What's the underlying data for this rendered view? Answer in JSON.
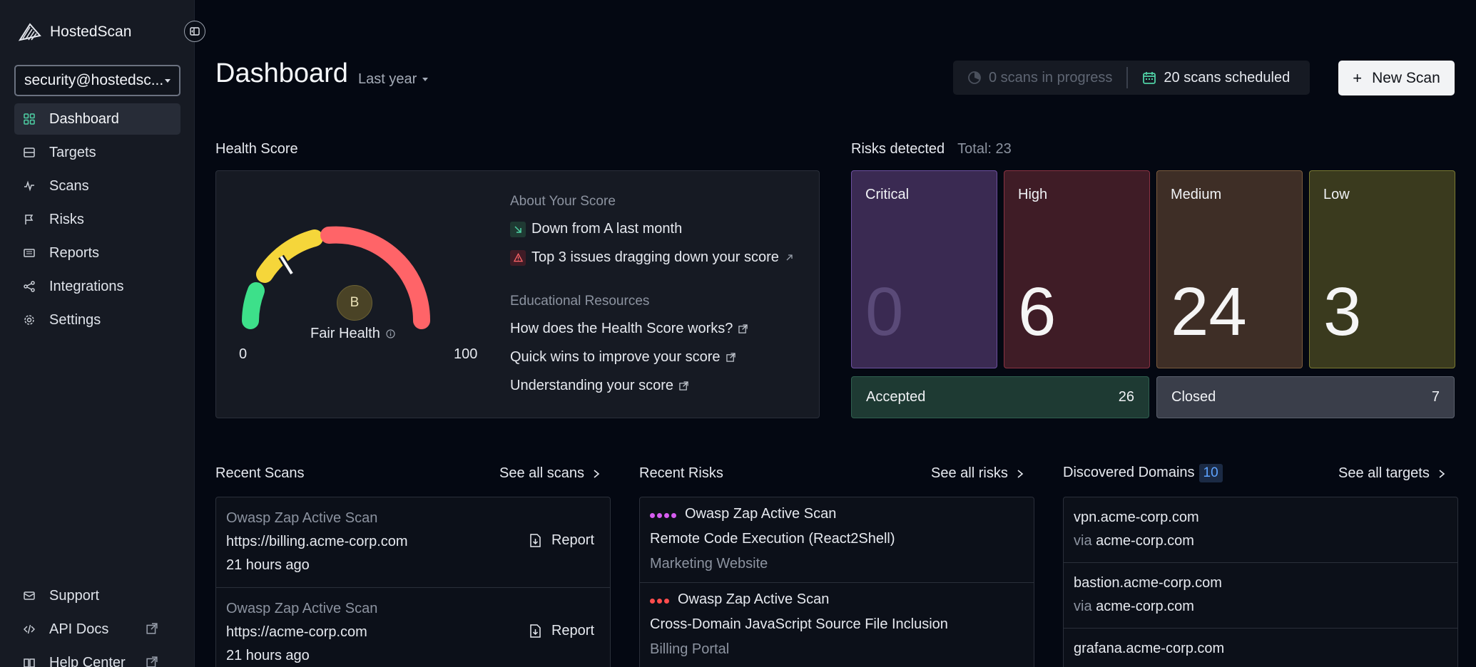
{
  "app": {
    "name": "HostedScan"
  },
  "account": {
    "email": "security@hostedsc..."
  },
  "nav": [
    {
      "label": "Dashboard",
      "icon": "grid-icon",
      "active": true
    },
    {
      "label": "Targets",
      "icon": "server-icon"
    },
    {
      "label": "Scans",
      "icon": "activity-icon"
    },
    {
      "label": "Risks",
      "icon": "flag-icon"
    },
    {
      "label": "Reports",
      "icon": "book-icon"
    },
    {
      "label": "Integrations",
      "icon": "share-icon"
    },
    {
      "label": "Settings",
      "icon": "gear-icon"
    }
  ],
  "nav_bottom": [
    {
      "label": "Support",
      "icon": "mail-icon"
    },
    {
      "label": "API Docs",
      "icon": "code-icon"
    },
    {
      "label": "Help Center",
      "icon": "book-open-icon"
    }
  ],
  "header": {
    "title": "Dashboard",
    "period": "Last year",
    "scans_in_progress": "0 scans in progress",
    "scans_scheduled": "20 scans scheduled",
    "new_scan": "New Scan"
  },
  "health": {
    "section_title": "Health Score",
    "grade": "B",
    "status": "Fair Health",
    "scale_min": "0",
    "scale_max": "100",
    "score_fraction": 0.25,
    "about_title": "About Your Score",
    "about_items": [
      "Down from A last month",
      "Top 3 issues dragging down your score"
    ],
    "edu_title": "Educational Resources",
    "edu_links": [
      "How does the Health Score works?",
      "Quick wins to improve your score",
      "Understanding your score"
    ]
  },
  "risks": {
    "section_title": "Risks detected",
    "total": "Total: 23",
    "tiles": [
      {
        "label": "Critical",
        "value": "0",
        "bg": "#3a2a52",
        "border": "#6d50a0",
        "num": "#5a4a78"
      },
      {
        "label": "High",
        "value": "6",
        "bg": "#3f1c26",
        "border": "#8a3242",
        "num": "#f5f5f5"
      },
      {
        "label": "Medium",
        "value": "24",
        "bg": "#3e2e26",
        "border": "#7a5a3c",
        "num": "#f5f5f5"
      },
      {
        "label": "Low",
        "value": "3",
        "bg": "#3a3a1e",
        "border": "#7a7a32",
        "num": "#f5f5f5"
      }
    ],
    "accepted": {
      "label": "Accepted",
      "value": "26"
    },
    "closed": {
      "label": "Closed",
      "value": "7"
    }
  },
  "recent_scans": {
    "title": "Recent Scans",
    "see_all": "See all scans",
    "report_label": "Report",
    "items": [
      {
        "type": "Owasp Zap Active Scan",
        "target": "https://billing.acme-corp.com",
        "time": "21 hours ago"
      },
      {
        "type": "Owasp Zap Active Scan",
        "target": "https://acme-corp.com",
        "time": "21 hours ago"
      }
    ]
  },
  "recent_risks": {
    "title": "Recent Risks",
    "see_all": "See all risks",
    "items": [
      {
        "scan": "Owasp Zap Active Scan",
        "risk": "Remote Code Execution (React2Shell)",
        "target": "Marketing Website",
        "dot_color": "#d65cf0",
        "dots": 4
      },
      {
        "scan": "Owasp Zap Active Scan",
        "risk": "Cross-Domain JavaScript Source File Inclusion",
        "target": "Billing Portal",
        "dot_color": "#ff4d4d",
        "dots": 3
      }
    ]
  },
  "domains": {
    "title": "Discovered Domains",
    "count": "10",
    "see_all": "See all targets",
    "via_prefix": "via",
    "items": [
      {
        "domain": "vpn.acme-corp.com",
        "via": "acme-corp.com"
      },
      {
        "domain": "bastion.acme-corp.com",
        "via": "acme-corp.com"
      },
      {
        "domain": "grafana.acme-corp.com",
        "via": ""
      }
    ]
  }
}
